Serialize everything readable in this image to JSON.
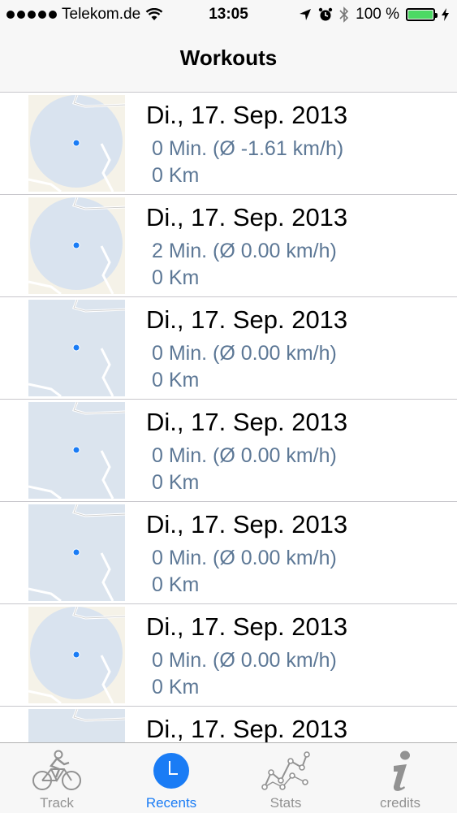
{
  "status_bar": {
    "carrier": "Telekom.de",
    "time": "13:05",
    "battery": "100 %"
  },
  "nav": {
    "title": "Workouts"
  },
  "workouts": [
    {
      "date": "Di., 17. Sep. 2013",
      "detail": "0 Min. (Ø -1.61 km/h)",
      "distance": "0 Km",
      "map": "circle"
    },
    {
      "date": "Di., 17. Sep. 2013",
      "detail": "2 Min. (Ø 0.00 km/h)",
      "distance": "0 Km",
      "map": "circle"
    },
    {
      "date": "Di., 17. Sep. 2013",
      "detail": "0 Min. (Ø 0.00 km/h)",
      "distance": "0 Km",
      "map": "plain"
    },
    {
      "date": "Di., 17. Sep. 2013",
      "detail": "0 Min. (Ø 0.00 km/h)",
      "distance": "0 Km",
      "map": "plain"
    },
    {
      "date": "Di., 17. Sep. 2013",
      "detail": "0 Min. (Ø 0.00 km/h)",
      "distance": "0 Km",
      "map": "plain"
    },
    {
      "date": "Di., 17. Sep. 2013",
      "detail": "0 Min. (Ø 0.00 km/h)",
      "distance": "0 Km",
      "map": "circle"
    },
    {
      "date": "Di., 17. Sep. 2013",
      "detail": "",
      "distance": "",
      "map": "plain"
    }
  ],
  "tabs": [
    {
      "label": "Track",
      "icon": "bicycle-icon",
      "active": false
    },
    {
      "label": "Recents",
      "icon": "clock-icon",
      "active": true
    },
    {
      "label": "Stats",
      "icon": "chart-icon",
      "active": false
    },
    {
      "label": "credits",
      "icon": "info-icon",
      "active": false
    }
  ],
  "colors": {
    "accent": "#1a7cf5",
    "detail_text": "#5d7896",
    "battery": "#4cd964"
  }
}
